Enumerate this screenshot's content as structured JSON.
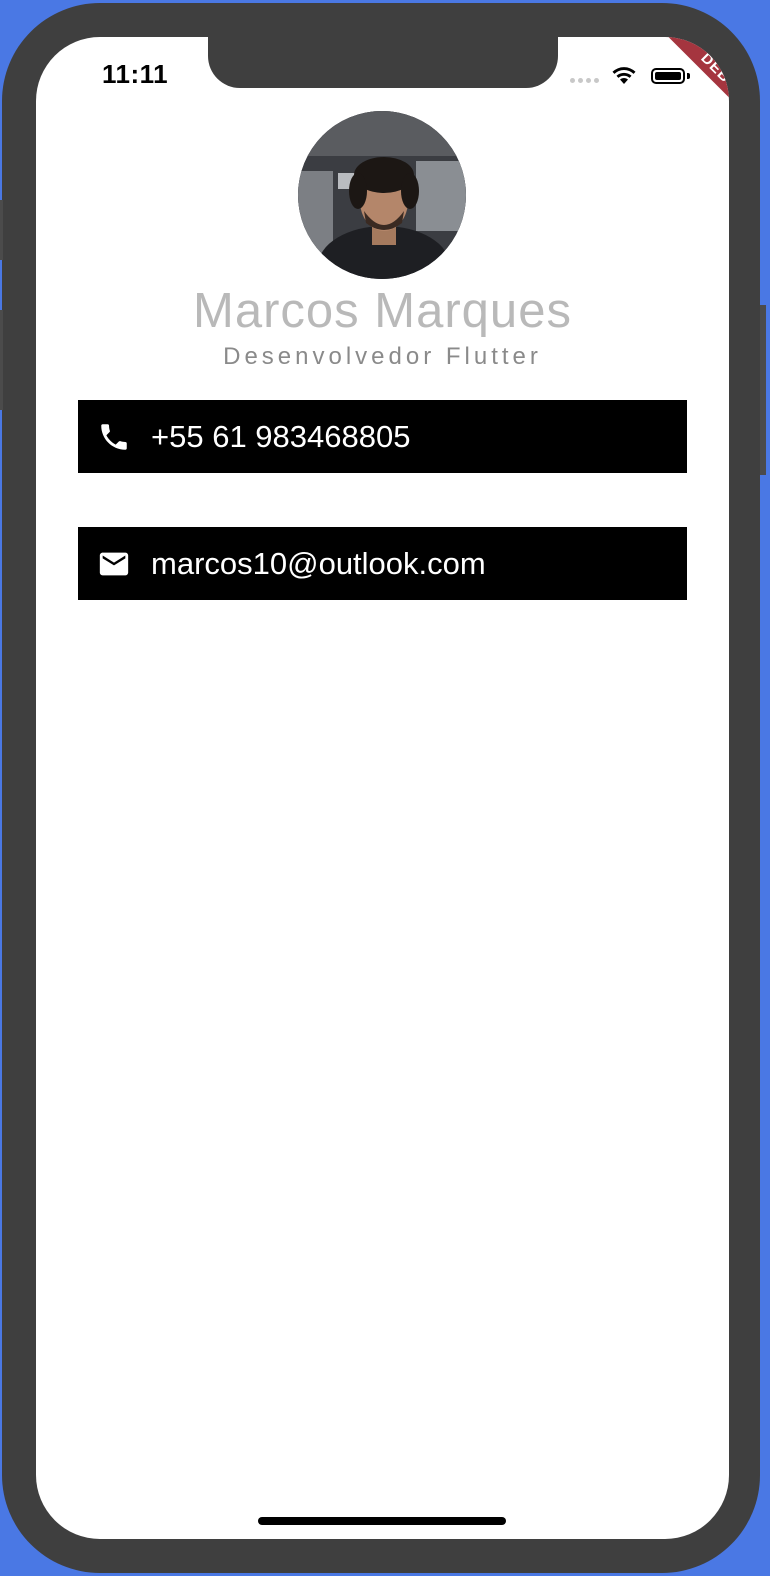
{
  "status_bar": {
    "time": "11:11",
    "debug_label": "DEBUG"
  },
  "profile": {
    "name": "Marcos Marques",
    "role": "Desenvolvedor Flutter",
    "avatar_icon": "profile-photo"
  },
  "contacts": [
    {
      "icon": "phone-icon",
      "value": "+55 61 983468805"
    },
    {
      "icon": "mail-icon",
      "value": "marcos10@outlook.com"
    }
  ],
  "colors": {
    "background": "#4a78e4",
    "device_frame": "#3f3f3f",
    "card": "#000000",
    "name_text": "#b9b9b9",
    "role_text": "#8a8a8a",
    "debug_banner": "#a5353f"
  }
}
